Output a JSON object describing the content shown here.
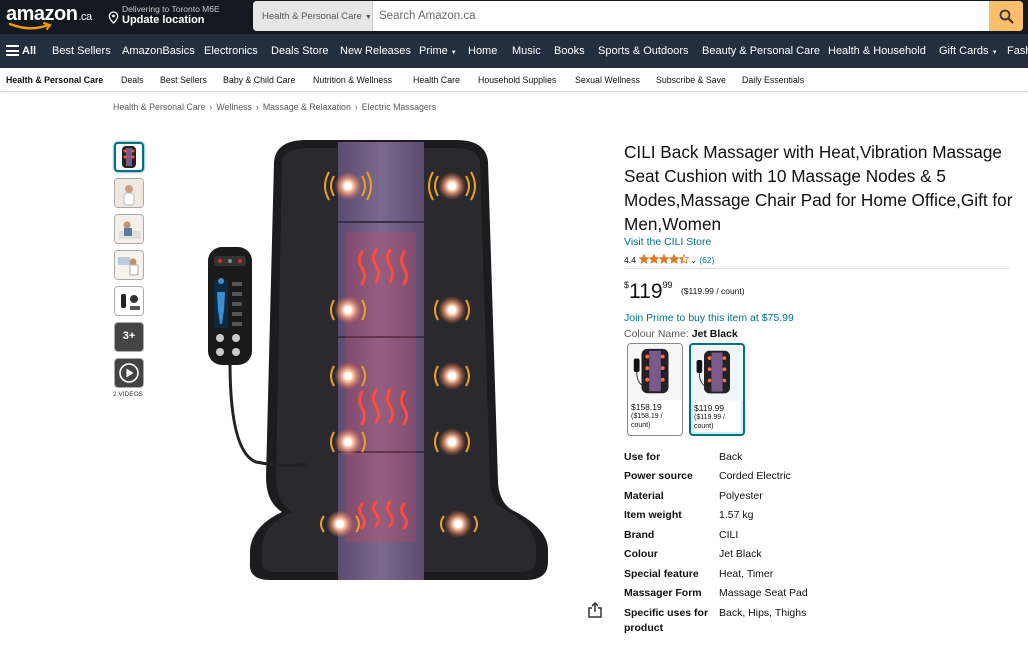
{
  "header": {
    "logo_text": "amazon",
    "logo_suffix": ".ca",
    "deliver_line1": "Delivering to Toronto M6E",
    "deliver_line2": "Update location",
    "search_category": "Health & Personal Care",
    "search_placeholder": "Search Amazon.ca"
  },
  "nav": {
    "all_label": "All",
    "items": [
      "Best Sellers",
      "AmazonBasics",
      "Electronics",
      "Deals Store",
      "New Releases",
      "Prime",
      "Home",
      "Music",
      "Books",
      "Sports & Outdoors",
      "Beauty & Personal Care",
      "Health & Household",
      "Gift Cards",
      "Fash"
    ]
  },
  "subnav": {
    "items": [
      "Health & Personal Care",
      "Deals",
      "Best Sellers",
      "Baby & Child Care",
      "Nutrition & Wellness",
      "Health Care",
      "Household Supplies",
      "Sexual Wellness",
      "Subscribe & Save",
      "Daily Essentials"
    ]
  },
  "breadcrumb": [
    "Health & Personal Care",
    "Wellness",
    "Massage & Relaxation",
    "Electric Massagers"
  ],
  "gallery": {
    "more_label": "3+",
    "videos_label": "2 VIDEOS"
  },
  "product": {
    "title": "CILI Back Massager with Heat,Vibration Massage Seat Cushion with 10 Massage Nodes & 5 Modes,Massage Chair Pad for Home Office,Gift for Men,Women",
    "store_link": "Visit the CILI Store",
    "rating": "4.4",
    "rating_value": 4.4,
    "review_count": "(62)",
    "price_currency": "$",
    "price_whole": "119",
    "price_fraction": "99",
    "price_per_unit": "($119.99 / count)",
    "prime_offer": "Join Prime to buy this item at $75.99",
    "colour_label": "Colour Name:",
    "colour_value": "Jet Black",
    "swatches": [
      {
        "price": "$158.19",
        "unit": "($158.19 / count)",
        "selected": false
      },
      {
        "price": "$119.99",
        "unit": "($119.99 / count)",
        "selected": true
      }
    ],
    "specs": [
      {
        "key": "Use for",
        "value": "Back"
      },
      {
        "key": "Power source",
        "value": "Corded Electric"
      },
      {
        "key": "Material",
        "value": "Polyester"
      },
      {
        "key": "Item weight",
        "value": "1.57 kg"
      },
      {
        "key": "Brand",
        "value": "CILI"
      },
      {
        "key": "Colour",
        "value": "Jet Black"
      },
      {
        "key": "Special feature",
        "value": "Heat, Timer"
      },
      {
        "key": "Massager Form",
        "value": "Massage Seat Pad"
      },
      {
        "key": "Specific uses for product",
        "value": "Back, Hips, Thighs"
      }
    ]
  },
  "colors": {
    "header_bg": "#131921",
    "nav_bg": "#232f3e",
    "search_button": "#febd69",
    "link": "#007185",
    "star": "#de7921"
  }
}
